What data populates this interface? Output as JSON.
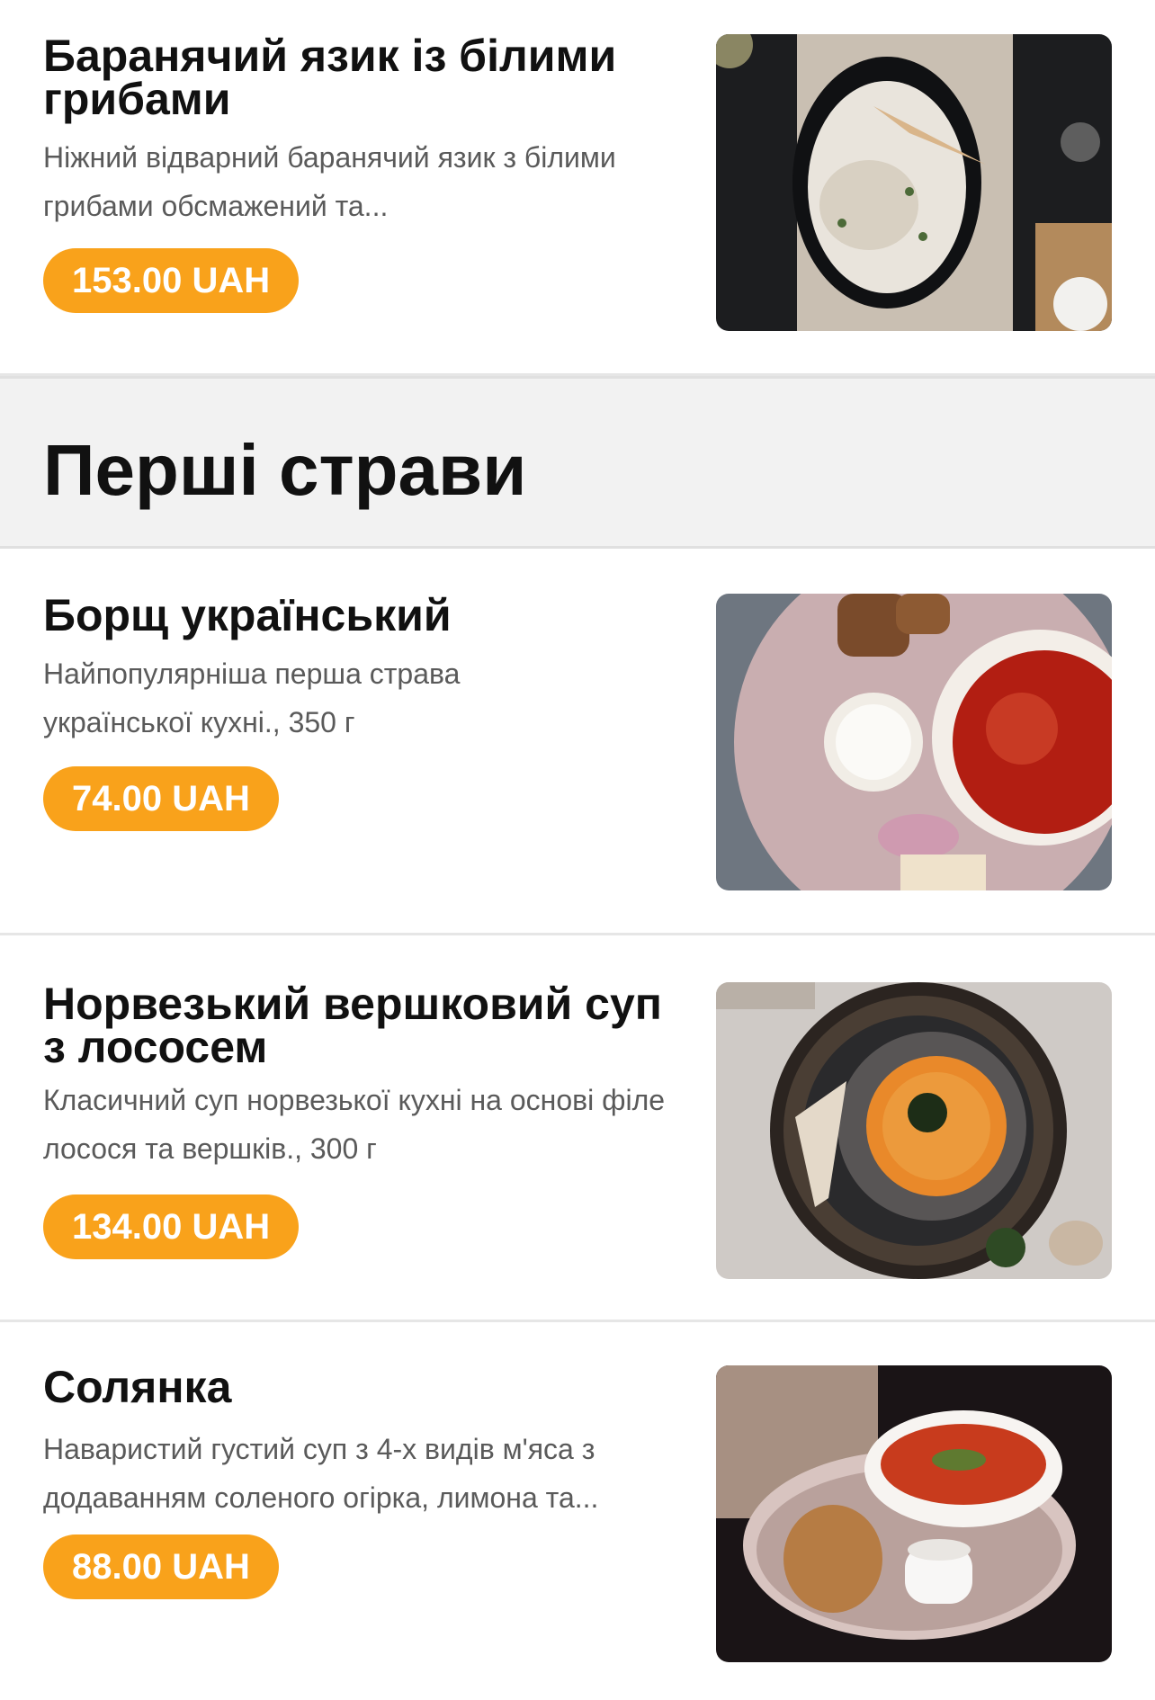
{
  "items_top": [
    {
      "title": "Баранячий язик із білими грибами",
      "description": "Ніжний відварний баранячий язик з білими грибами обсмажений та...",
      "price": "153.00 UAH"
    }
  ],
  "section": {
    "title": "Перші страви",
    "items": [
      {
        "title": "Борщ український",
        "description": "Найпопулярніша перша страва української кухні., 350 г",
        "price": "74.00 UAH"
      },
      {
        "title": "Норвезький вершковий суп з лососем",
        "description": "Класичний суп норвезької кухні на основі філе лосося та вершків., 300 г",
        "price": "134.00 UAH"
      },
      {
        "title": "Солянка",
        "description": "Наваристий густий суп з 4-х видів м'яса з додаванням соленого огірка, лимона та...",
        "price": "88.00 UAH"
      }
    ]
  },
  "colors": {
    "accent": "#f9a21b",
    "section_bg": "#f2f2f2",
    "title": "#111111",
    "description": "#5a5a5a"
  }
}
